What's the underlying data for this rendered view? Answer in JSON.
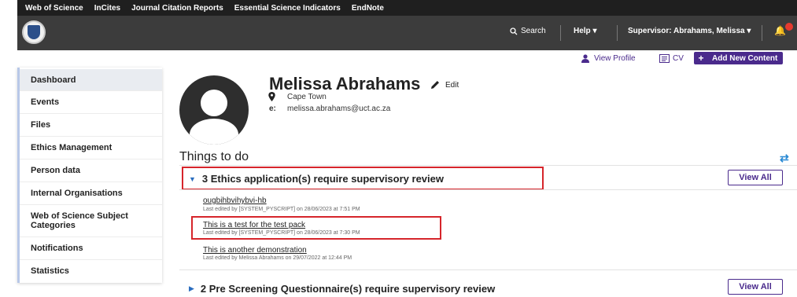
{
  "product_bar": {
    "links": [
      "Web of Science",
      "InCites",
      "Journal Citation Reports",
      "Essential Science Indicators",
      "EndNote"
    ]
  },
  "header": {
    "search_label": "Search",
    "help_label": "Help",
    "supervisor_label": "Supervisor: Abrahams, Melissa"
  },
  "actions": {
    "view_profile": "View Profile",
    "cv": "CV",
    "add_new_content": "Add New Content"
  },
  "sidebar": {
    "items": [
      {
        "label": "Dashboard",
        "active": true
      },
      {
        "label": "Events"
      },
      {
        "label": "Files"
      },
      {
        "label": "Ethics Management"
      },
      {
        "label": "Person data"
      },
      {
        "label": "Internal Organisations"
      },
      {
        "label": "Web of Science Subject Categories"
      },
      {
        "label": "Notifications"
      },
      {
        "label": "Statistics"
      }
    ]
  },
  "profile": {
    "name": "Melissa Abrahams",
    "edit_label": "Edit",
    "location": "Cape Town",
    "email_key": "e:",
    "email": "melissa.abrahams@uct.ac.za"
  },
  "todo": {
    "title": "Things to do",
    "sections": [
      {
        "title": "3 Ethics application(s) require supervisory review",
        "view_all": "View All",
        "expanded": true,
        "items": [
          {
            "title": "ougbihbvihybvi-hb",
            "meta": "Last edited by [SYSTEM_PYSCRIPT] on 28/06/2023 at 7:51 PM"
          },
          {
            "title": "This is a test for the test pack",
            "meta": "Last edited by [SYSTEM_PYSCRIPT] on 28/06/2023 at 7:30 PM"
          },
          {
            "title": "This is another demonstration",
            "meta": "Last edited by Melissa Abrahams on 29/07/2022 at 12:44 PM"
          }
        ]
      },
      {
        "title": "2 Pre Screening Questionnaire(s) require supervisory review",
        "view_all": "View All",
        "expanded": false
      }
    ]
  },
  "colors": {
    "header_bg": "#3c3c3c",
    "accent_purple": "#4a2a8c",
    "highlight_red": "#d6252b",
    "link_blue": "#2a6dbf"
  }
}
